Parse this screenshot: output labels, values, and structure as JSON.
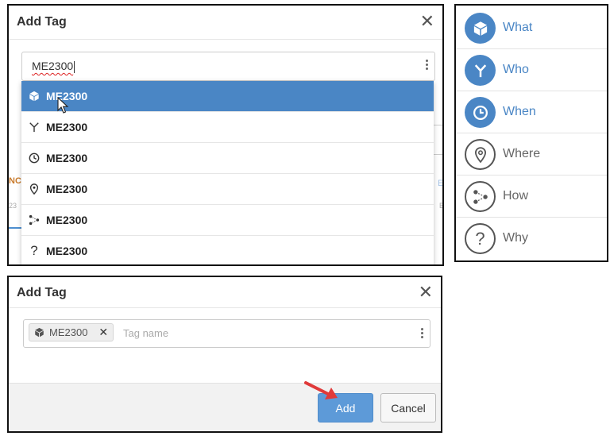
{
  "dropdown_dialog": {
    "title": "Add Tag",
    "close_label": "✕",
    "input_value": "ME2300",
    "menu_items": [
      {
        "icon": "cube-icon",
        "label": "ME2300",
        "active": true
      },
      {
        "icon": "person-icon",
        "label": "ME2300",
        "active": false
      },
      {
        "icon": "clock-icon",
        "label": "ME2300",
        "active": false
      },
      {
        "icon": "location-pin-icon",
        "label": "ME2300",
        "active": false
      },
      {
        "icon": "network-icon",
        "label": "ME2300",
        "active": false
      },
      {
        "icon": "question-icon",
        "label": "ME2300",
        "active": false
      }
    ]
  },
  "categories": [
    {
      "label": "What",
      "icon": "cube-icon",
      "style": "filled"
    },
    {
      "label": "Who",
      "icon": "person-icon",
      "style": "filled"
    },
    {
      "label": "When",
      "icon": "clock-icon",
      "style": "filled"
    },
    {
      "label": "Where",
      "icon": "location-pin-icon",
      "style": "outline"
    },
    {
      "label": "How",
      "icon": "network-icon",
      "style": "outline"
    },
    {
      "label": "Why",
      "icon": "question-icon",
      "style": "outline"
    }
  ],
  "tag_dialog": {
    "title": "Add Tag",
    "close_label": "✕",
    "chip_label": "ME2300",
    "chip_icon": "cube-icon",
    "chip_remove": "✕",
    "placeholder": "Tag name",
    "add_label": "Add",
    "cancel_label": "Cancel"
  },
  "colors": {
    "accent": "#4a86c5",
    "button": "#5d9ad8",
    "arrow": "#e03a3a"
  }
}
